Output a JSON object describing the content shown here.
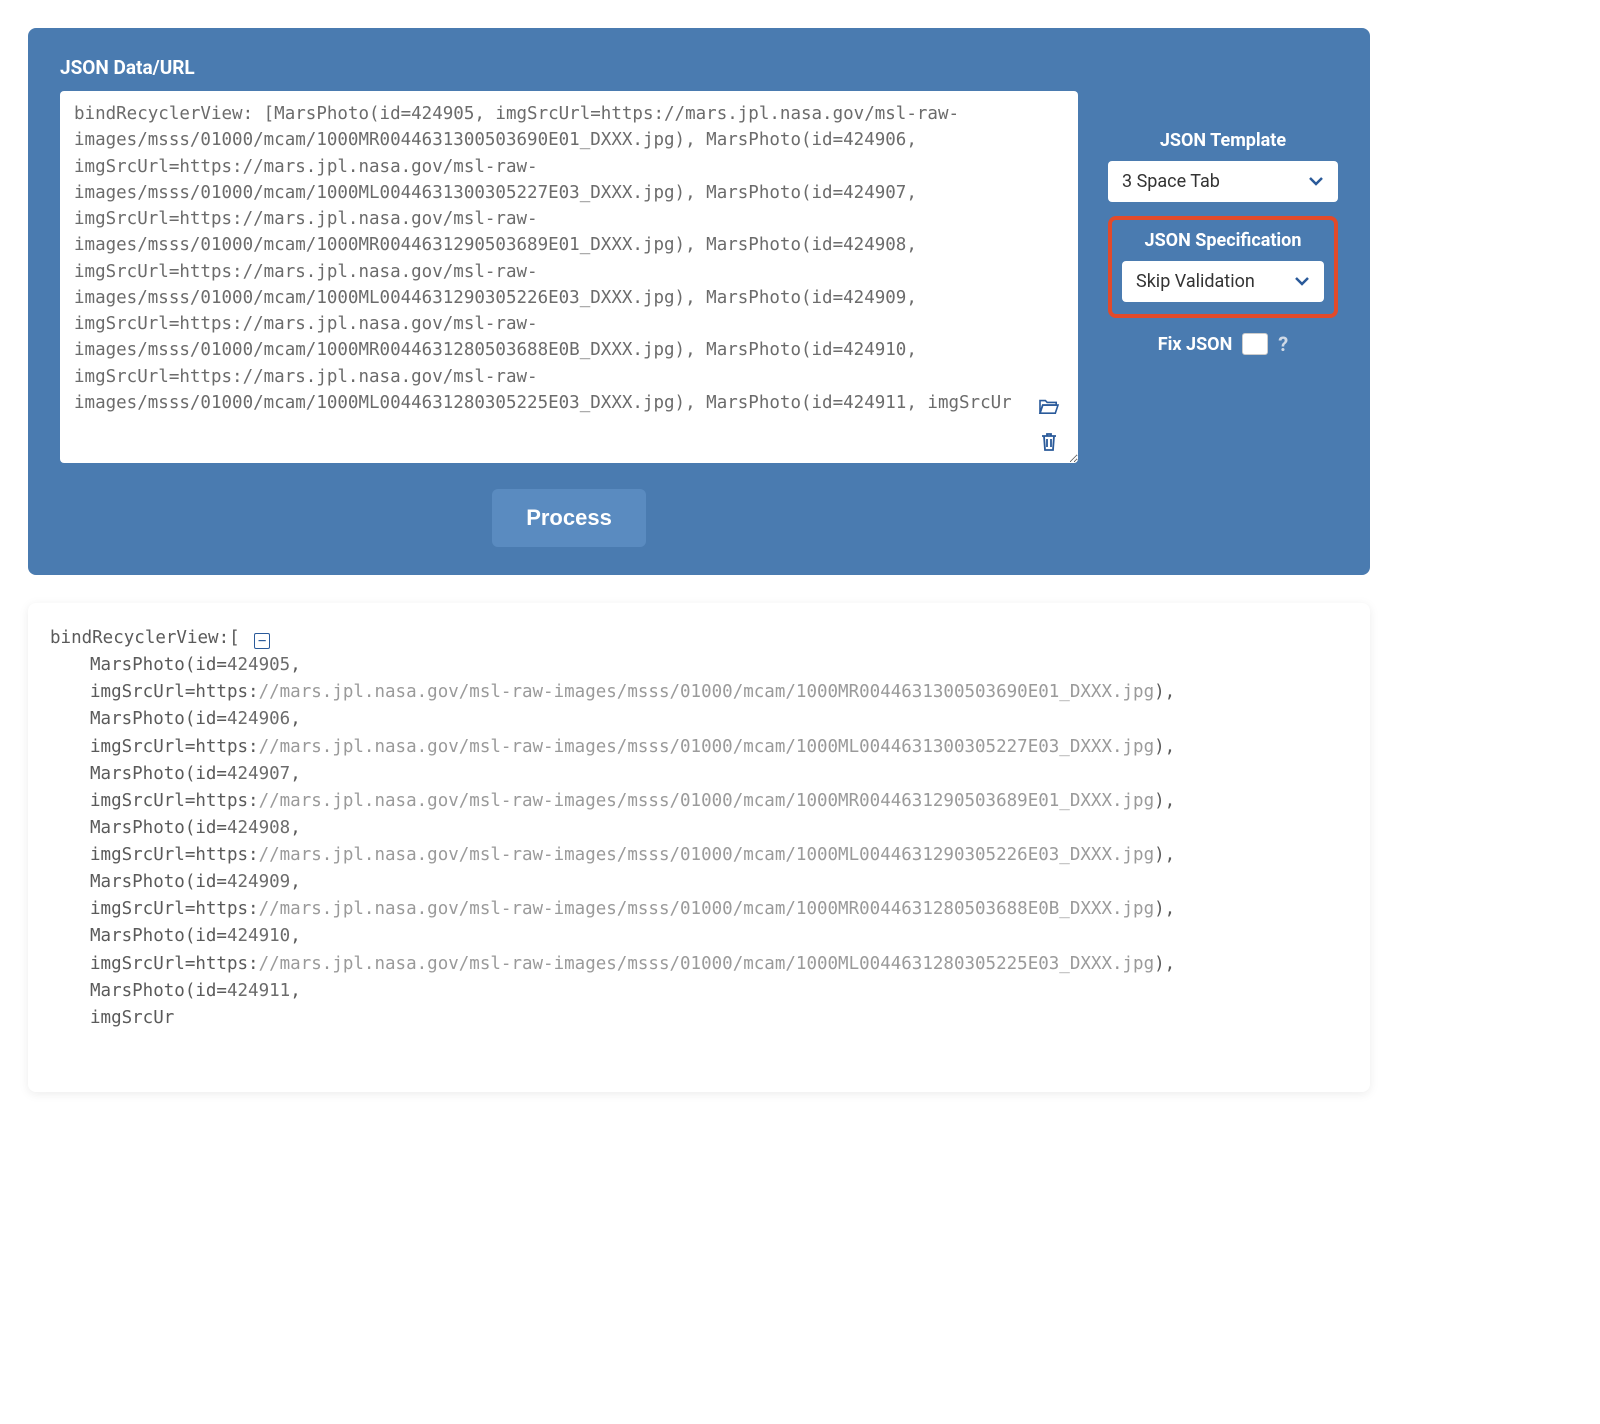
{
  "panel": {
    "title": "JSON Data/URL",
    "textarea_value": "bindRecyclerView: [MarsPhoto(id=424905, imgSrcUrl=https://mars.jpl.nasa.gov/msl-raw-images/msss/01000/mcam/1000MR0044631300503690E01_DXXX.jpg), MarsPhoto(id=424906, imgSrcUrl=https://mars.jpl.nasa.gov/msl-raw-images/msss/01000/mcam/1000ML0044631300305227E03_DXXX.jpg), MarsPhoto(id=424907, imgSrcUrl=https://mars.jpl.nasa.gov/msl-raw-images/msss/01000/mcam/1000MR0044631290503689E01_DXXX.jpg), MarsPhoto(id=424908, imgSrcUrl=https://mars.jpl.nasa.gov/msl-raw-images/msss/01000/mcam/1000ML0044631290305226E03_DXXX.jpg), MarsPhoto(id=424909, imgSrcUrl=https://mars.jpl.nasa.gov/msl-raw-images/msss/01000/mcam/1000MR0044631280503688E0B_DXXX.jpg), MarsPhoto(id=424910, imgSrcUrl=https://mars.jpl.nasa.gov/msl-raw-images/msss/01000/mcam/1000ML0044631280305225E03_DXXX.jpg), MarsPhoto(id=424911, imgSrcUr",
    "process_label": "Process"
  },
  "sidebar": {
    "template_label": "JSON Template",
    "template_value": "3 Space Tab",
    "spec_label": "JSON Specification",
    "spec_value": "Skip Validation",
    "fix_label": "Fix JSON",
    "fix_checked": false,
    "help_glyph": "?"
  },
  "output": {
    "root_key": "bindRecyclerView",
    "collapse_glyph": "⊟",
    "entries": [
      {
        "id": "424905",
        "url": "//mars.jpl.nasa.gov/msl-raw-images/msss/01000/mcam/1000MR0044631300503690E01_DXXX.jpg"
      },
      {
        "id": "424906",
        "url": "//mars.jpl.nasa.gov/msl-raw-images/msss/01000/mcam/1000ML0044631300305227E03_DXXX.jpg"
      },
      {
        "id": "424907",
        "url": "//mars.jpl.nasa.gov/msl-raw-images/msss/01000/mcam/1000MR0044631290503689E01_DXXX.jpg"
      },
      {
        "id": "424908",
        "url": "//mars.jpl.nasa.gov/msl-raw-images/msss/01000/mcam/1000ML0044631290305226E03_DXXX.jpg"
      },
      {
        "id": "424909",
        "url": "//mars.jpl.nasa.gov/msl-raw-images/msss/01000/mcam/1000MR0044631280503688E0B_DXXX.jpg"
      },
      {
        "id": "424910",
        "url": "//mars.jpl.nasa.gov/msl-raw-images/msss/01000/mcam/1000ML0044631280305225E03_DXXX.jpg"
      }
    ],
    "trailing_id": "424911",
    "trailing_partial": "imgSrcUr",
    "labels": {
      "mars_prefix": "MarsPhoto(id=",
      "img_prefix": "imgSrcUrl=https:",
      "open": ":[",
      "comma": ",",
      "close_entry": "),"
    }
  },
  "colors": {
    "panel_bg": "#4a7bb0",
    "highlight_border": "#e24a2a",
    "accent": "#2a5a9a"
  }
}
